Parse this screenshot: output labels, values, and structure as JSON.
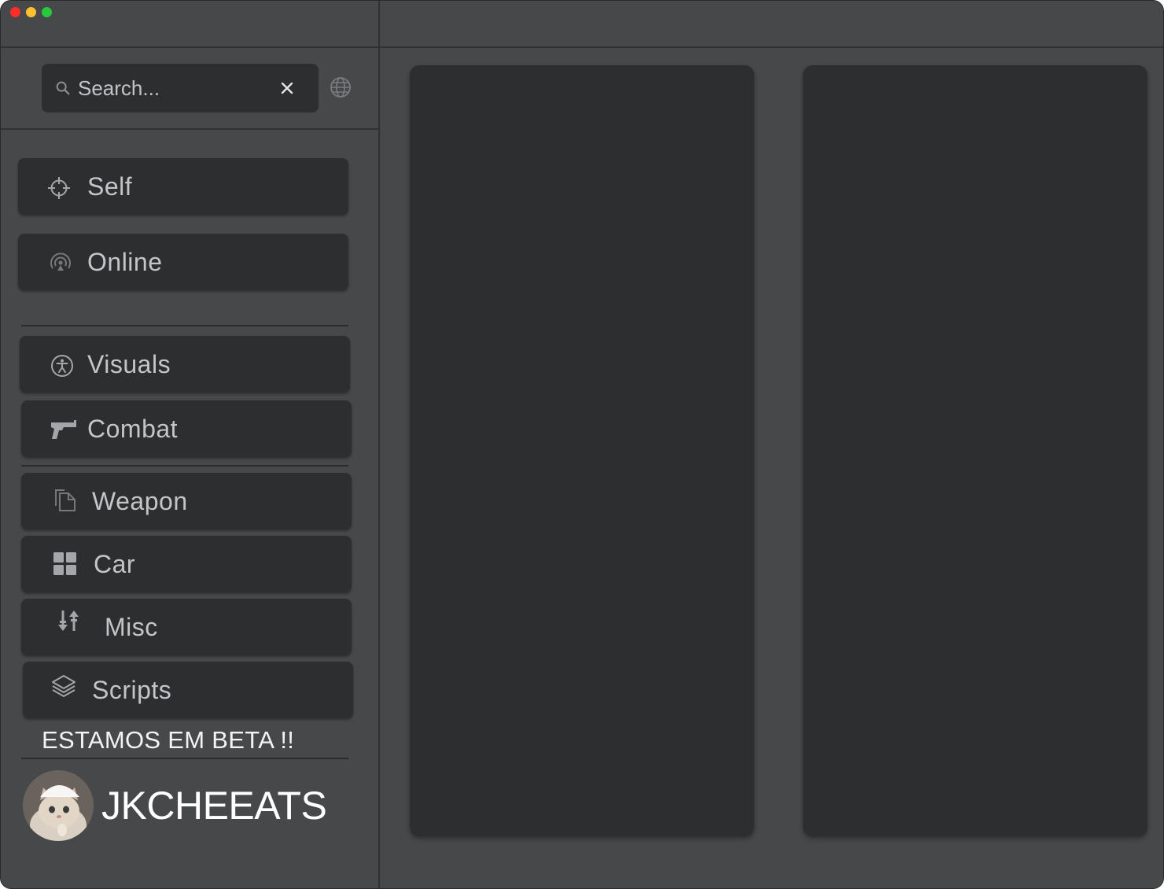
{
  "window": {
    "controls": [
      "close",
      "minimize",
      "zoom"
    ]
  },
  "search": {
    "placeholder": "Search...",
    "clear_icon": "close-icon",
    "icon": "search-icon"
  },
  "language_icon": "globe-icon",
  "nav": {
    "self": {
      "label": "Self",
      "icon": "crosshair-icon"
    },
    "online": {
      "label": "Online",
      "icon": "broadcast-icon"
    },
    "visuals": {
      "label": "Visuals",
      "icon": "accessibility-icon"
    },
    "combat": {
      "label": "Combat",
      "icon": "pistol-icon"
    },
    "weapon": {
      "label": "Weapon",
      "icon": "copy-icon"
    },
    "car": {
      "label": "Car",
      "icon": "grid-icon"
    },
    "misc": {
      "label": "Misc",
      "icon": "sort-arrows-icon"
    },
    "scripts": {
      "label": "Scripts",
      "icon": "layers-icon"
    }
  },
  "footer": {
    "beta_notice": "ESTAMOS EM BETA !!",
    "brand": "JKCHEEATS"
  },
  "colors": {
    "window_bg": "#47484a",
    "panel_bg": "#2d2e30",
    "text": "#c4c5c8"
  }
}
